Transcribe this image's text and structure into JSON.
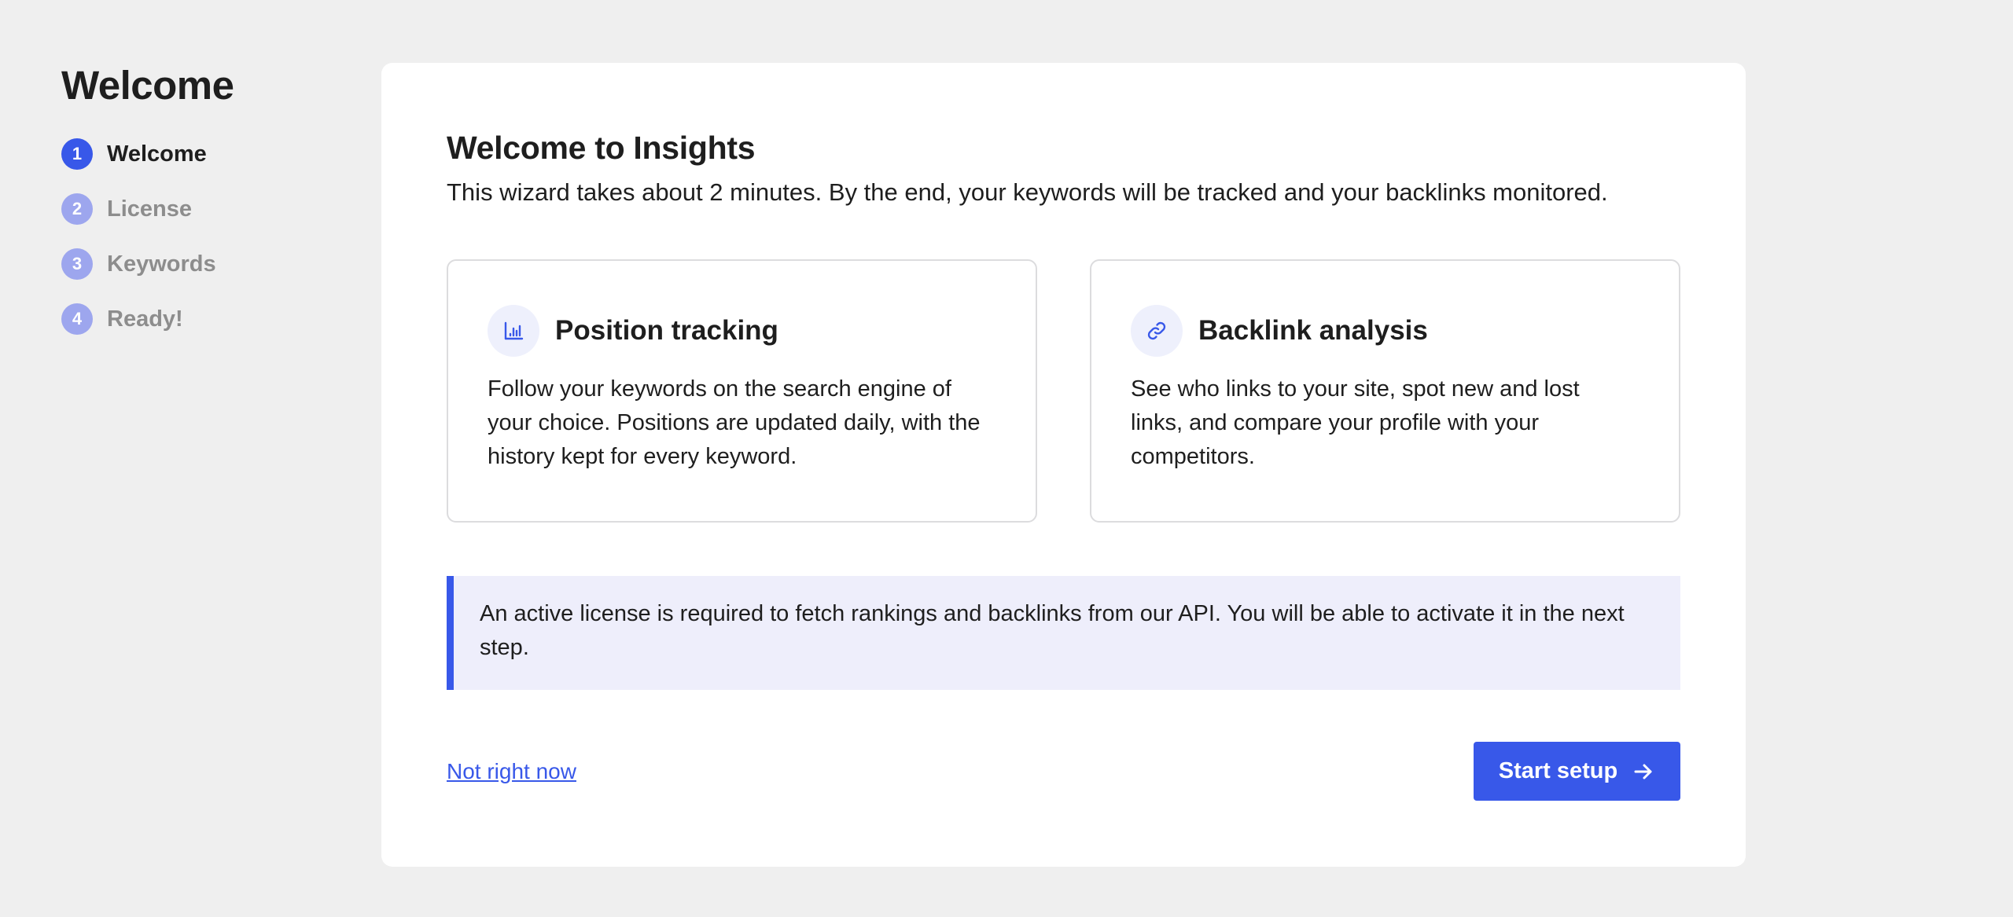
{
  "sidebar": {
    "title": "Welcome",
    "steps": [
      {
        "number": "1",
        "label": "Welcome",
        "active": true
      },
      {
        "number": "2",
        "label": "License",
        "active": false
      },
      {
        "number": "3",
        "label": "Keywords",
        "active": false
      },
      {
        "number": "4",
        "label": "Ready!",
        "active": false
      }
    ]
  },
  "main": {
    "title": "Welcome to Insights",
    "subtitle": "This wizard takes about 2 minutes. By the end, your keywords will be tracked and your backlinks monitored.",
    "features": [
      {
        "icon": "bar-chart-icon",
        "title": "Position tracking",
        "description": "Follow your keywords on the search engine of your choice. Positions are updated daily, with the history kept for every keyword."
      },
      {
        "icon": "link-icon",
        "title": "Backlink analysis",
        "description": "See who links to your site, spot new and lost links, and compare your profile with your competitors."
      }
    ],
    "notice": "An active license is required to fetch rankings and backlinks from our API. You will be able to activate it in the next step.",
    "skip_label": "Not right now",
    "start_label": "Start setup"
  },
  "colors": {
    "accent": "#3858e9",
    "accent_muted": "#9da6ee",
    "notice_bg": "#eeeefb",
    "page_bg": "#efefef"
  }
}
